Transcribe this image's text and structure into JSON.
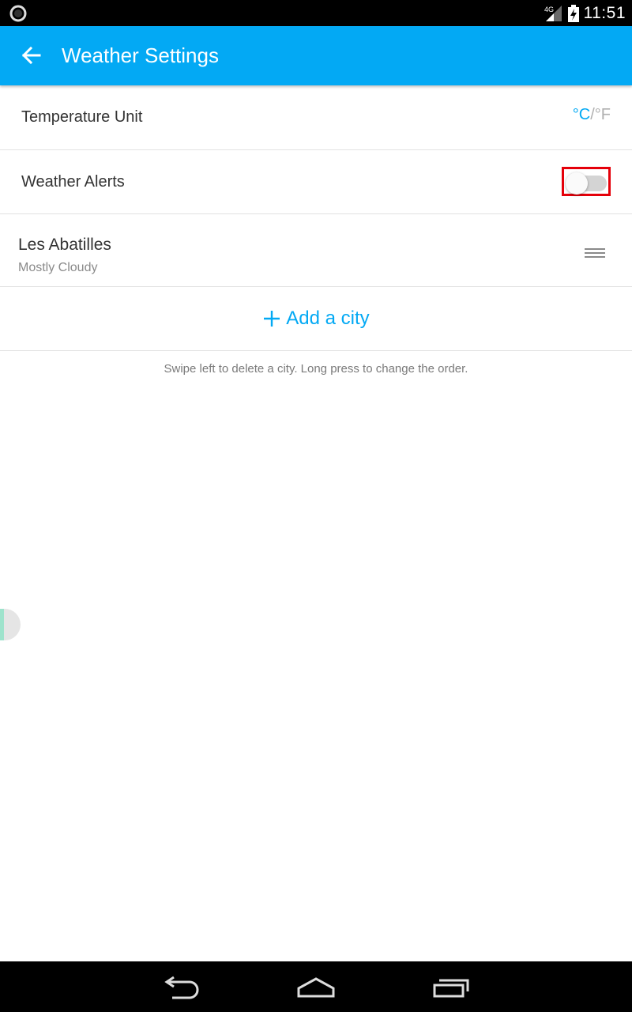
{
  "status_bar": {
    "network": "4G",
    "time": "11:51",
    "icons": [
      "notification-circle-icon",
      "signal-icon",
      "battery-charging-icon"
    ]
  },
  "app_bar": {
    "title": "Weather Settings",
    "back_icon": "arrow-back-icon",
    "color": "#03A9F4"
  },
  "settings": {
    "temperature_unit": {
      "label": "Temperature Unit",
      "celsius": "°C",
      "separator": "/",
      "fahrenheit": "°F",
      "selected": "°C"
    },
    "weather_alerts": {
      "label": "Weather Alerts",
      "enabled": false
    }
  },
  "cities": [
    {
      "name": "Les Abatilles",
      "condition": "Mostly Cloudy",
      "handle_icon": "drag-handle-icon"
    }
  ],
  "add_city": {
    "icon": "plus-icon",
    "label": "Add a city"
  },
  "hint": "Swipe left to delete a city. Long press to change the order.",
  "nav_bar": {
    "buttons": [
      "back-icon",
      "home-icon",
      "recent-apps-icon"
    ]
  }
}
